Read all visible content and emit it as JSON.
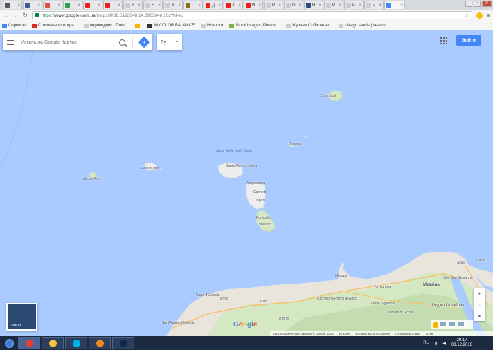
{
  "browser": {
    "tabs": [
      {
        "title": "",
        "color": "#555555"
      },
      {
        "title": "",
        "color": "#3b5998"
      },
      {
        "title": "",
        "color": "#e24c3c"
      },
      {
        "title": "",
        "color": "#2ba34a"
      },
      {
        "title": "",
        "color": "#e62117"
      },
      {
        "title": "",
        "color": "#e62117"
      },
      {
        "title": "В",
        "color": "#cccccc"
      },
      {
        "title": "Б",
        "color": "#cccccc"
      },
      {
        "title": "У",
        "color": "#cccccc"
      },
      {
        "title": "Г",
        "color": "#8a6d1a"
      },
      {
        "title": "Д",
        "color": "#e62117"
      },
      {
        "title": "Х",
        "color": "#e62117"
      },
      {
        "title": "И",
        "color": "#e62117"
      },
      {
        "title": "Р",
        "color": "#cccccc"
      },
      {
        "title": "G",
        "color": "#cccccc"
      },
      {
        "title": "Н",
        "color": "#274b82"
      },
      {
        "title": "Р",
        "color": "#cccccc"
      },
      {
        "title": "Р",
        "color": "#cccccc"
      },
      {
        "title": "Р",
        "color": "#cccccc"
      },
      {
        "title": "",
        "color": "#4285f4",
        "active": true
      }
    ],
    "url": {
      "scheme": "https://",
      "host": "www.google.com.ua",
      "path": "/maps/@38.5193648,14.8983846,10z?hl=ru"
    },
    "bookmarks": [
      {
        "label": "Сервисы",
        "color": "#4285f4"
      },
      {
        "label": "Стоковые фотогра...",
        "color": "#d93025"
      },
      {
        "label": "переводчик - Поис...",
        "color": "#cccccc"
      },
      {
        "label": "",
        "color": "#f6b400"
      },
      {
        "label": "IN COLOR BALANCE",
        "color": "#333333"
      },
      {
        "label": "Новости",
        "color": "#cccccc"
      },
      {
        "label": "Stock Images, Photos...",
        "color": "#7cb342"
      },
      {
        "label": "Журнал Собирател...",
        "color": "#cccccc"
      },
      {
        "label": "design seeds | search",
        "color": "#cccccc"
      }
    ]
  },
  "maps": {
    "search_placeholder": "Искать на Google Картах",
    "language": "Ру",
    "signin_label": "Войти",
    "earth_label": "Земля",
    "zoom_in": "+",
    "zoom_out": "−",
    "sea_label": "Mare delle isole Eolie",
    "places": [
      {
        "name": "Stromboli"
      },
      {
        "name": "Panarea"
      },
      {
        "name": "Santa Marina Salina"
      },
      {
        "name": "Filicudi Porto"
      },
      {
        "name": "Alicudi Porto"
      },
      {
        "name": "Acquacalda"
      },
      {
        "name": "Canneto"
      },
      {
        "name": "Lipari"
      },
      {
        "name": "Porticello"
      },
      {
        "name": "Vulcano"
      },
      {
        "name": "Milazzo"
      },
      {
        "name": "Barcellona Pozzo di Gotto"
      },
      {
        "name": "Capo d'Orlando"
      },
      {
        "name": "Brolo"
      },
      {
        "name": "Patti"
      },
      {
        "name": "Sant'Agata di Militello"
      },
      {
        "name": "Messina"
      },
      {
        "name": "Villa San Giovanni"
      },
      {
        "name": "Реджо Калабрия"
      },
      {
        "name": "Torregrotta"
      },
      {
        "name": "Scilla"
      },
      {
        "name": "Terme Vigliatore"
      },
      {
        "name": "Novara di Sicilia"
      },
      {
        "name": "Tortorici"
      },
      {
        "name": "Palmi"
      }
    ],
    "attribution": {
      "data": "Картографические данные © Google 2016",
      "country": "Италия",
      "terms": "Условия использования",
      "feedback": "Отправить отзыв",
      "scale": "10 км"
    }
  },
  "taskbar": {
    "apps": [
      {
        "name": "chrome",
        "color": "#db4437"
      },
      {
        "name": "explorer",
        "color": "#f6c343"
      },
      {
        "name": "skype",
        "color": "#00aff0"
      },
      {
        "name": "media",
        "color": "#f08a24"
      },
      {
        "name": "photoshop",
        "color": "#0d2a4f"
      }
    ],
    "lang": "RU",
    "time": "20:17",
    "date": "03.12.2016"
  }
}
